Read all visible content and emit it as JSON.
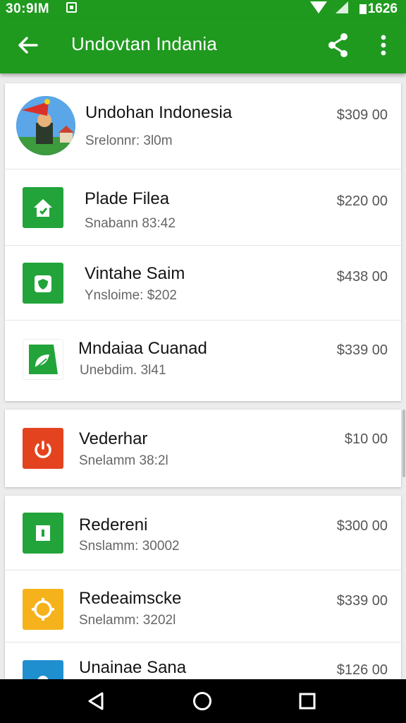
{
  "status_bar": {
    "time": "30:9IM",
    "clock": "1626"
  },
  "app_bar": {
    "title": "Undovtan Indania"
  },
  "items": [
    {
      "title": "Undohan Indonesia",
      "subtitle": "Srelonnr: 3l0m",
      "price": "$309 00",
      "icon": "avatar-image"
    },
    {
      "title": "Plade Filea",
      "subtitle": "Snabann 83:42",
      "price": "$220 00",
      "icon": "home-icon",
      "color": "#22a43b"
    },
    {
      "title": "Vintahe Saim",
      "subtitle": "Ynsloime: $202",
      "price": "$438 00",
      "icon": "shield-icon",
      "color": "#22a43b"
    },
    {
      "title": "Mndaiaa Cuanad",
      "subtitle": "Unebdim. 3l41",
      "price": "$339 00",
      "icon": "leaf-icon",
      "color": "#22a43b"
    },
    {
      "title": "Vederhar",
      "subtitle": "Snelamm 38:2l",
      "price": "$10 00",
      "icon": "power-icon",
      "color": "#e4431f"
    },
    {
      "title": "Redereni",
      "subtitle": "Snslamm: 30002",
      "price": "$300 00",
      "icon": "info-icon",
      "color": "#22a43b"
    },
    {
      "title": "Redeaimscke",
      "subtitle": "Snelamm: 3202l",
      "price": "$339 00",
      "icon": "gear-icon",
      "color": "#f6b21b"
    },
    {
      "title": "Unainae Sana",
      "price": "$126 00",
      "icon": "camera-icon",
      "color": "#1f8fd0"
    }
  ]
}
